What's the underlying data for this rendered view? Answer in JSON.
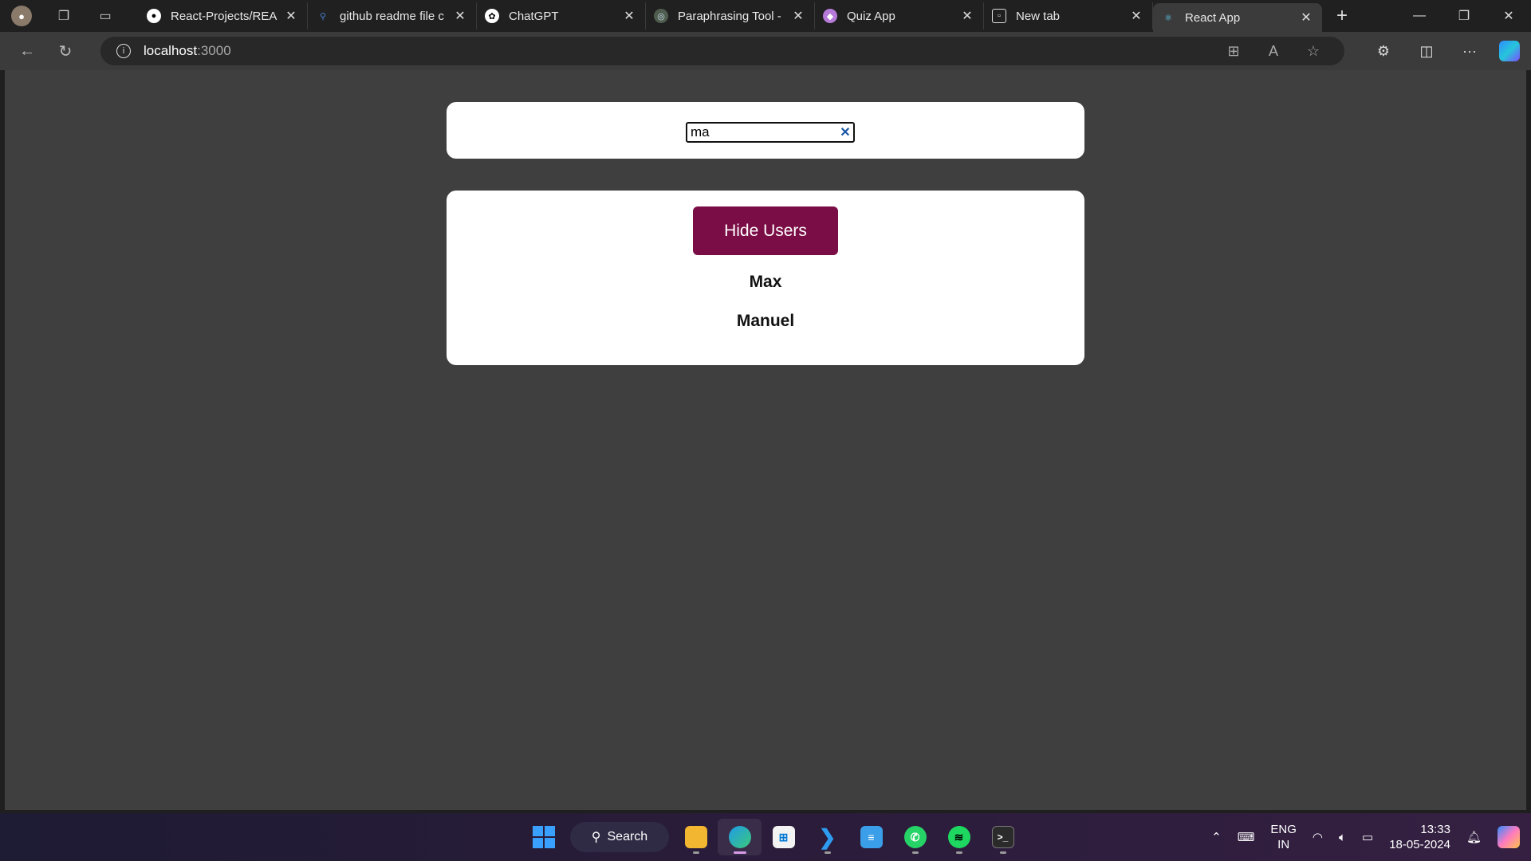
{
  "browser": {
    "tabs": [
      {
        "title": "React-Projects/REA",
        "favicon": "github-icon",
        "active": false
      },
      {
        "title": "github readme file c",
        "favicon": "search-icon",
        "active": false
      },
      {
        "title": "ChatGPT",
        "favicon": "chatgpt-icon",
        "active": false
      },
      {
        "title": "Paraphrasing Tool -",
        "favicon": "paraphrase-icon",
        "active": false
      },
      {
        "title": "Quiz App",
        "favicon": "quiz-icon",
        "active": false
      },
      {
        "title": "New tab",
        "favicon": "newtab-icon",
        "active": false
      },
      {
        "title": "React App",
        "favicon": "react-icon",
        "active": true
      }
    ],
    "address": {
      "host": "localhost",
      "port": ":3000"
    }
  },
  "app": {
    "search": {
      "value": "ma"
    },
    "toggle_button_label": "Hide Users",
    "users": [
      "Max",
      "Manuel"
    ],
    "accent_color": "#7a0d45"
  },
  "taskbar": {
    "search_label": "Search",
    "language": "ENG",
    "region": "IN",
    "time": "13:33",
    "date": "18-05-2024"
  }
}
